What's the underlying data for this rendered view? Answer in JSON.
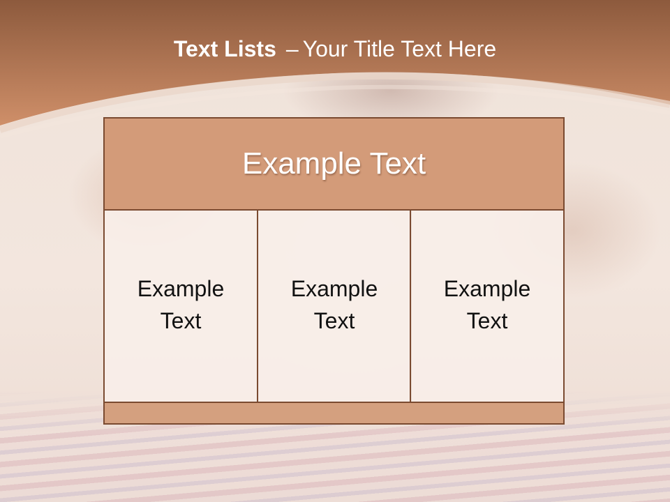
{
  "slide": {
    "title_main": "Text Lists",
    "title_separator": "–",
    "title_sub": "Your Title Text Here"
  },
  "table": {
    "header": "Example Text",
    "columns": [
      "Example Text",
      "Example Text",
      "Example Text"
    ],
    "footer": ""
  },
  "colors": {
    "band_top": "#8d5a3d",
    "band_bottom": "#cf8f69",
    "header_fill": "#d39b79",
    "border": "#7a4a30",
    "cell_fill": "#f8eee9",
    "footer_fill": "#d4a07f"
  }
}
